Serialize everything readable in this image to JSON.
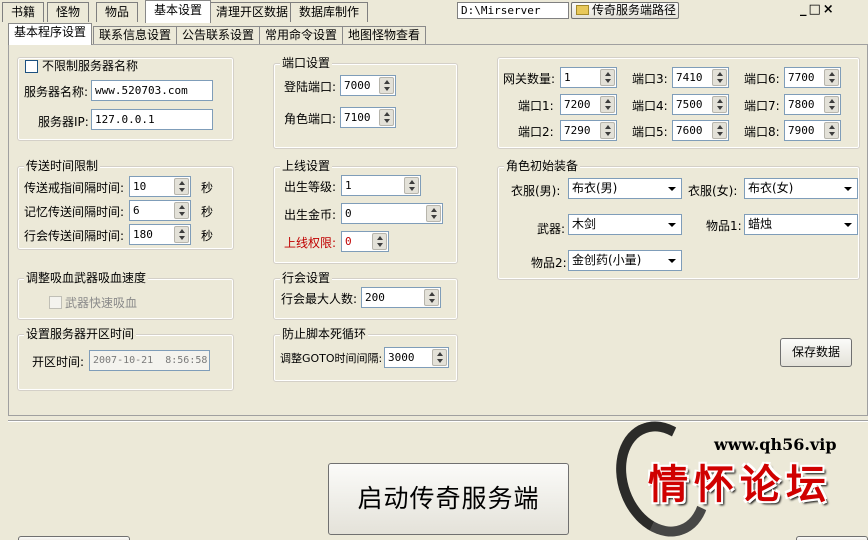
{
  "top_tabs": [
    "书籍",
    "怪物",
    "物品",
    "基本设置",
    "清理开区数据",
    "数据库制作"
  ],
  "path_field": "D:\\Mirserver",
  "path_button": "传奇服务端路径",
  "sub_tabs": [
    "基本程序设置",
    "联系信息设置",
    "公告联系设置",
    "常用命令设置",
    "地图怪物查看"
  ],
  "server": {
    "unlimited_label": "不限制服务器名称",
    "name_label": "服务器名称:",
    "name_value": "www.520703.com",
    "ip_label": "服务器IP:",
    "ip_value": "127.0.0.1"
  },
  "ports": {
    "title": "端口设置",
    "login_label": "登陆端口:",
    "login_value": "7000",
    "role_label": "角色端口:",
    "role_value": "7100"
  },
  "gateway": {
    "count_label": "网关数量:",
    "count_value": "1",
    "ports": [
      {
        "label": "端口1:",
        "value": "7200"
      },
      {
        "label": "端口2:",
        "value": "7290"
      },
      {
        "label": "端口3:",
        "value": "7410"
      },
      {
        "label": "端口4:",
        "value": "7500"
      },
      {
        "label": "端口5:",
        "value": "7600"
      },
      {
        "label": "端口6:",
        "value": "7700"
      },
      {
        "label": "端口7:",
        "value": "7800"
      },
      {
        "label": "端口8:",
        "value": "7900"
      }
    ]
  },
  "teleport": {
    "title": "传送时间限制",
    "rows": [
      {
        "label": "传送戒指间隔时间:",
        "value": "10",
        "unit": "秒"
      },
      {
        "label": "记忆传送间隔时间:",
        "value": "6",
        "unit": "秒"
      },
      {
        "label": "行会传送间隔时间:",
        "value": "180",
        "unit": "秒"
      }
    ]
  },
  "online": {
    "title": "上线设置",
    "level_label": "出生等级:",
    "level_value": "1",
    "gold_label": "出生金币:",
    "gold_value": "0",
    "perm_label": "上线权限:",
    "perm_value": "0"
  },
  "equip": {
    "title": "角色初始装备",
    "male_label": "衣服(男):",
    "male_value": "布衣(男)",
    "female_label": "衣服(女):",
    "female_value": "布衣(女)",
    "weapon_label": "武器:",
    "weapon_value": "木剑",
    "item1_label": "物品1:",
    "item1_value": "蜡烛",
    "item2_label": "物品2:",
    "item2_value": "金创药(小量)"
  },
  "vampire": {
    "title": "调整吸血武器吸血速度",
    "check_label": "武器快速吸血"
  },
  "guild": {
    "title": "行会设置",
    "max_label": "行会最大人数:",
    "max_value": "200"
  },
  "open_time": {
    "title": "设置服务器开区时间",
    "label": "开区时间:",
    "value": "2007-10-21  8:56:58"
  },
  "script_loop": {
    "title": "防止脚本死循环",
    "label": "调整GOTO时间间隔:",
    "value": "3000"
  },
  "save_button": "保存数据",
  "start_button": "启动传奇服务端",
  "watermark": {
    "url": "www.qh56.vip",
    "logo_text": "情怀论坛"
  },
  "window_controls": [
    "_",
    "□",
    "×"
  ],
  "colors": {
    "background": "#ece9d8",
    "accent_red": "#c00000",
    "logo_red": "#d00000"
  }
}
